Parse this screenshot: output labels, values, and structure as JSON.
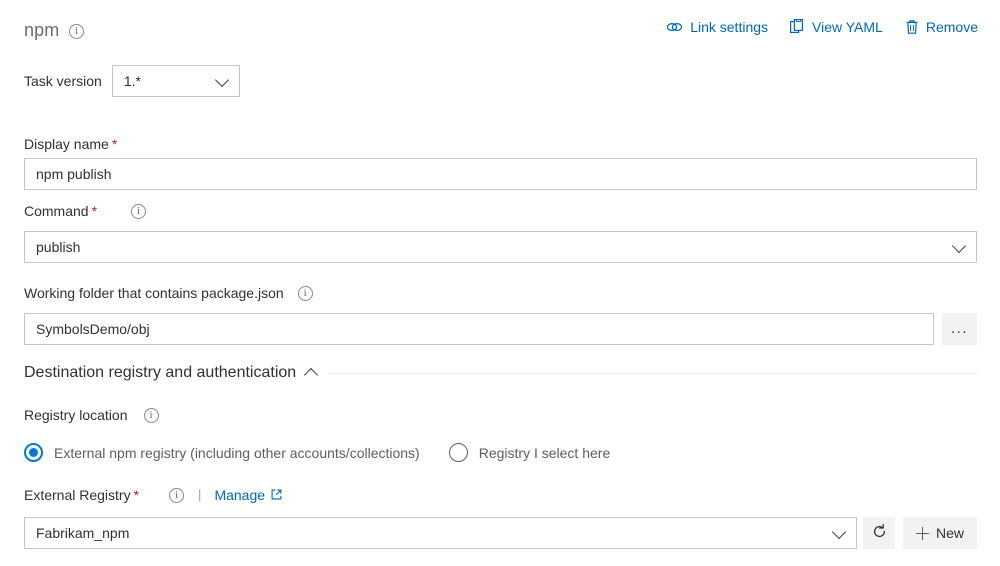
{
  "header": {
    "task_title": "npm",
    "info_icon": "info-icon",
    "actions": [
      {
        "label": "Link settings",
        "icon": "link-icon"
      },
      {
        "label": "View YAML",
        "icon": "clipboard-icon"
      },
      {
        "label": "Remove",
        "icon": "trash-icon"
      }
    ]
  },
  "task_version": {
    "label": "Task version",
    "value": "1.*"
  },
  "display_name": {
    "label": "Display name",
    "required": "*",
    "value": "npm publish"
  },
  "command": {
    "label": "Command",
    "required": "*",
    "value": "publish"
  },
  "working_folder": {
    "label": "Working folder that contains package.json",
    "value": "SymbolsDemo/obj",
    "browse_label": "..."
  },
  "section": {
    "title": "Destination registry and authentication",
    "chevron": "chevron-up-icon"
  },
  "registry_location": {
    "label": "Registry location",
    "options": [
      {
        "label": "External npm registry (including other accounts/collections)",
        "selected": true
      },
      {
        "label": "Registry I select here",
        "selected": false
      }
    ]
  },
  "external_registry": {
    "label": "External Registry",
    "required": "*",
    "separator": "|",
    "manage_label": "Manage",
    "manage_icon": "external-link-icon",
    "value": "Fabrikam_npm",
    "refresh_icon": "refresh-icon",
    "new_label": "New",
    "new_icon": "plus-icon"
  },
  "colors": {
    "link": "#0067b8",
    "accent": "#0078d4",
    "required": "#a4262c",
    "border": "#c8c6c4",
    "button_bg": "#f3f2f1",
    "text": "#323130",
    "muted": "#605e5c"
  }
}
